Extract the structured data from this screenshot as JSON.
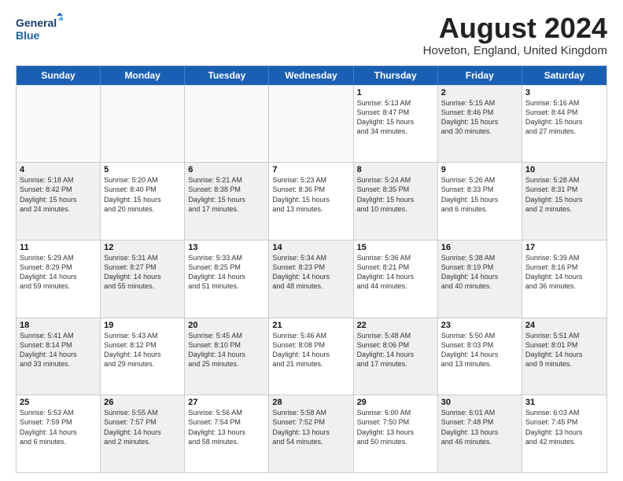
{
  "header": {
    "logo_line1": "General",
    "logo_line2": "Blue",
    "month_title": "August 2024",
    "location": "Hoveton, England, United Kingdom"
  },
  "weekdays": [
    "Sunday",
    "Monday",
    "Tuesday",
    "Wednesday",
    "Thursday",
    "Friday",
    "Saturday"
  ],
  "rows": [
    [
      {
        "day": "",
        "detail": "",
        "empty": true
      },
      {
        "day": "",
        "detail": "",
        "empty": true
      },
      {
        "day": "",
        "detail": "",
        "empty": true
      },
      {
        "day": "",
        "detail": "",
        "empty": true
      },
      {
        "day": "1",
        "detail": "Sunrise: 5:13 AM\nSunset: 8:47 PM\nDaylight: 15 hours\nand 34 minutes."
      },
      {
        "day": "2",
        "detail": "Sunrise: 5:15 AM\nSunset: 8:46 PM\nDaylight: 15 hours\nand 30 minutes.",
        "shaded": true
      },
      {
        "day": "3",
        "detail": "Sunrise: 5:16 AM\nSunset: 8:44 PM\nDaylight: 15 hours\nand 27 minutes."
      }
    ],
    [
      {
        "day": "4",
        "detail": "Sunrise: 5:18 AM\nSunset: 8:42 PM\nDaylight: 15 hours\nand 24 minutes.",
        "shaded": true
      },
      {
        "day": "5",
        "detail": "Sunrise: 5:20 AM\nSunset: 8:40 PM\nDaylight: 15 hours\nand 20 minutes."
      },
      {
        "day": "6",
        "detail": "Sunrise: 5:21 AM\nSunset: 8:38 PM\nDaylight: 15 hours\nand 17 minutes.",
        "shaded": true
      },
      {
        "day": "7",
        "detail": "Sunrise: 5:23 AM\nSunset: 8:36 PM\nDaylight: 15 hours\nand 13 minutes."
      },
      {
        "day": "8",
        "detail": "Sunrise: 5:24 AM\nSunset: 8:35 PM\nDaylight: 15 hours\nand 10 minutes.",
        "shaded": true
      },
      {
        "day": "9",
        "detail": "Sunrise: 5:26 AM\nSunset: 8:33 PM\nDaylight: 15 hours\nand 6 minutes."
      },
      {
        "day": "10",
        "detail": "Sunrise: 5:28 AM\nSunset: 8:31 PM\nDaylight: 15 hours\nand 2 minutes.",
        "shaded": true
      }
    ],
    [
      {
        "day": "11",
        "detail": "Sunrise: 5:29 AM\nSunset: 8:29 PM\nDaylight: 14 hours\nand 59 minutes."
      },
      {
        "day": "12",
        "detail": "Sunrise: 5:31 AM\nSunset: 8:27 PM\nDaylight: 14 hours\nand 55 minutes.",
        "shaded": true
      },
      {
        "day": "13",
        "detail": "Sunrise: 5:33 AM\nSunset: 8:25 PM\nDaylight: 14 hours\nand 51 minutes."
      },
      {
        "day": "14",
        "detail": "Sunrise: 5:34 AM\nSunset: 8:23 PM\nDaylight: 14 hours\nand 48 minutes.",
        "shaded": true
      },
      {
        "day": "15",
        "detail": "Sunrise: 5:36 AM\nSunset: 8:21 PM\nDaylight: 14 hours\nand 44 minutes."
      },
      {
        "day": "16",
        "detail": "Sunrise: 5:38 AM\nSunset: 8:19 PM\nDaylight: 14 hours\nand 40 minutes.",
        "shaded": true
      },
      {
        "day": "17",
        "detail": "Sunrise: 5:39 AM\nSunset: 8:16 PM\nDaylight: 14 hours\nand 36 minutes."
      }
    ],
    [
      {
        "day": "18",
        "detail": "Sunrise: 5:41 AM\nSunset: 8:14 PM\nDaylight: 14 hours\nand 33 minutes.",
        "shaded": true
      },
      {
        "day": "19",
        "detail": "Sunrise: 5:43 AM\nSunset: 8:12 PM\nDaylight: 14 hours\nand 29 minutes."
      },
      {
        "day": "20",
        "detail": "Sunrise: 5:45 AM\nSunset: 8:10 PM\nDaylight: 14 hours\nand 25 minutes.",
        "shaded": true
      },
      {
        "day": "21",
        "detail": "Sunrise: 5:46 AM\nSunset: 8:08 PM\nDaylight: 14 hours\nand 21 minutes."
      },
      {
        "day": "22",
        "detail": "Sunrise: 5:48 AM\nSunset: 8:06 PM\nDaylight: 14 hours\nand 17 minutes.",
        "shaded": true
      },
      {
        "day": "23",
        "detail": "Sunrise: 5:50 AM\nSunset: 8:03 PM\nDaylight: 14 hours\nand 13 minutes."
      },
      {
        "day": "24",
        "detail": "Sunrise: 5:51 AM\nSunset: 8:01 PM\nDaylight: 14 hours\nand 9 minutes.",
        "shaded": true
      }
    ],
    [
      {
        "day": "25",
        "detail": "Sunrise: 5:53 AM\nSunset: 7:59 PM\nDaylight: 14 hours\nand 6 minutes."
      },
      {
        "day": "26",
        "detail": "Sunrise: 5:55 AM\nSunset: 7:57 PM\nDaylight: 14 hours\nand 2 minutes.",
        "shaded": true
      },
      {
        "day": "27",
        "detail": "Sunrise: 5:56 AM\nSunset: 7:54 PM\nDaylight: 13 hours\nand 58 minutes."
      },
      {
        "day": "28",
        "detail": "Sunrise: 5:58 AM\nSunset: 7:52 PM\nDaylight: 13 hours\nand 54 minutes.",
        "shaded": true
      },
      {
        "day": "29",
        "detail": "Sunrise: 6:00 AM\nSunset: 7:50 PM\nDaylight: 13 hours\nand 50 minutes."
      },
      {
        "day": "30",
        "detail": "Sunrise: 6:01 AM\nSunset: 7:48 PM\nDaylight: 13 hours\nand 46 minutes.",
        "shaded": true
      },
      {
        "day": "31",
        "detail": "Sunrise: 6:03 AM\nSunset: 7:45 PM\nDaylight: 13 hours\nand 42 minutes."
      }
    ]
  ]
}
